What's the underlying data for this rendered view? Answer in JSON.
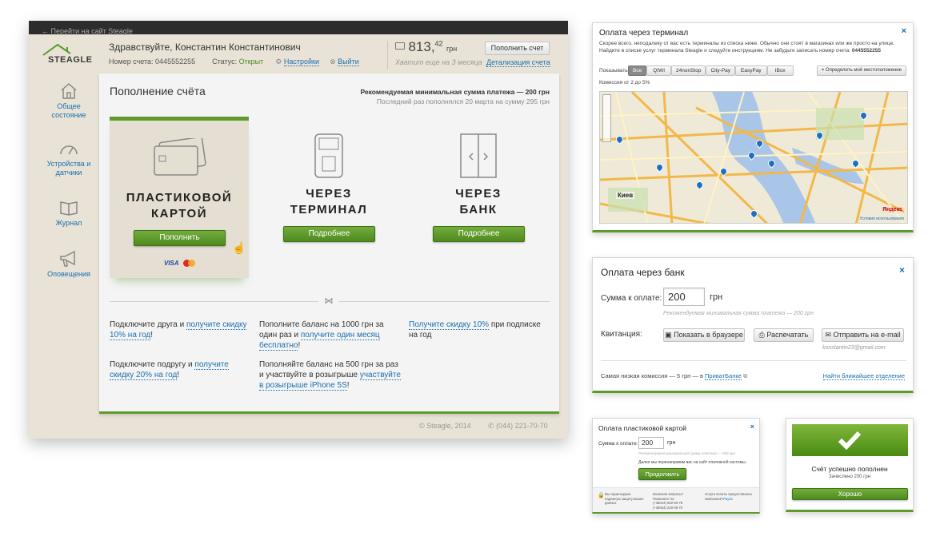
{
  "app": {
    "topbar_link": "← Перейти на сайт Steagle",
    "logo": "STEAGLE",
    "greeting": "Здравствуйте, Константин Константинович",
    "account_label": "Номер счета:",
    "account_number": "0445552255",
    "status_label": "Статус:",
    "status_value": "Открыт",
    "settings": "Настройки",
    "logout": "Выйти",
    "balance_main": "813,",
    "balance_cents": "42",
    "currency": "грн",
    "balance_hint": "Хватит еще на 3 месяца",
    "topup_button": "Пополнить счет",
    "details_link": "Детализация счета"
  },
  "sidebar": {
    "items": [
      {
        "label": "Общее состояние",
        "icon": "home-icon"
      },
      {
        "label": "Устройства и датчики",
        "icon": "gauge-icon"
      },
      {
        "label": "Журнал",
        "icon": "book-icon"
      },
      {
        "label": "Оповещения",
        "icon": "megaphone-icon"
      }
    ]
  },
  "main": {
    "title": "Пополнение счёта",
    "min_sum": "Рекомендуемая минимальная сумма платежа — 200 грн",
    "last_topup": "Последний раз пополнялся 20 марта на сумму 295 грн",
    "methods": [
      {
        "title1": "ПЛАСТИКОВОЙ",
        "title2": "КАРТОЙ",
        "button": "Пополнить",
        "icon": "credit-card-icon"
      },
      {
        "title1": "ЧЕРЕЗ",
        "title2": "ТЕРМИНАЛ",
        "button": "Подробнее",
        "icon": "terminal-icon"
      },
      {
        "title1": "ЧЕРЕЗ",
        "title2": "БАНК",
        "button": "Подробнее",
        "icon": "door-icon"
      }
    ],
    "visa": "VISA",
    "promos": {
      "p1_text": "Подключите друга и ",
      "p1_link": "получите скидку 10% на год",
      "p1_end": "!",
      "p2_text": "Подключите подругу и ",
      "p2_link": "получите скидку 20% на год",
      "p2_end": "!",
      "p3_text": "Пополните баланс на 1000 грн за один раз и ",
      "p3_link": "получите один месяц бесплатно",
      "p3_end": "!",
      "p4_text": "Пополняйте баланс на 500 грн за раз и участвуйте в розыгрыше ",
      "p4_link": "участвуйте в розыгрыше iPhone 5S",
      "p4_end": "!",
      "p5_link": "Получите скидку 10%",
      "p5_text": " при подписке на год"
    },
    "footer_copy": "© Steagle, 2014",
    "footer_phone": "(044) 221-70-70"
  },
  "terminal_panel": {
    "title": "Оплата через терминал",
    "desc": "Скорее всего, неподалеку от вас есть терминалы из списка ниже. Обычно они стоят в магазинах или же просто на улице. Найдите в списке услуг терминала Steagle и следуйте инструкциям. Не забудьте записать номер счета:",
    "account": "0445552255",
    "show_label": "Показывать",
    "tabs": [
      "Все",
      "QIWI",
      "24nonStop",
      "City-Pay",
      "EasyPay",
      "IBox"
    ],
    "locate_button": "Определить моё местоположение",
    "commission": "Комиссия от 2 до 5%",
    "map_city": "Киев",
    "map_brand": "Яндекс",
    "map_terms": "Условия использования"
  },
  "bank_panel": {
    "title": "Оплата через банк",
    "sum_label": "Сумма к оплате:",
    "sum_value": "200",
    "currency": "грн",
    "hint": "Рекомендуемая минимальная сумма платежа — 200 грн",
    "receipt_label": "Квитанция:",
    "btn_browser": "Показать в браузере",
    "btn_print": "Распечатать",
    "btn_email": "Отправить на e-mail",
    "email": "konstantin23@gmail.com",
    "commission_text": "Самая низкая комиссия — 5 грн — в ",
    "bank_link": "ПриватБанке",
    "nearest_link": "Найти ближайшее отделение"
  },
  "card_panel": {
    "title": "Оплата пластиковой картой",
    "sum_label": "Сумма к оплате:",
    "sum_value": "200",
    "currency": "грн",
    "hint": "Рекомендуемая минимальная сумма платежа — 200 грн",
    "redirect_text": "Далее мы перенаправим вас на сайт платежной системы.",
    "continue_button": "Продолжить",
    "foot1": "Мы гарантируем надежную защиту ваших данных",
    "foot2a": "Возникли вопросы? Позвоните по:",
    "foot2b": "(+38044) 502-50-78",
    "foot2c": "(+38044) 220-05-70",
    "foot3": "Услуга оплаты предоставлена компанией ",
    "foot3_link": "iPayza"
  },
  "success_panel": {
    "title": "Счёт успешно пополнен",
    "subtitle": "Зачислено 200 грн",
    "ok_button": "Хорошо"
  }
}
